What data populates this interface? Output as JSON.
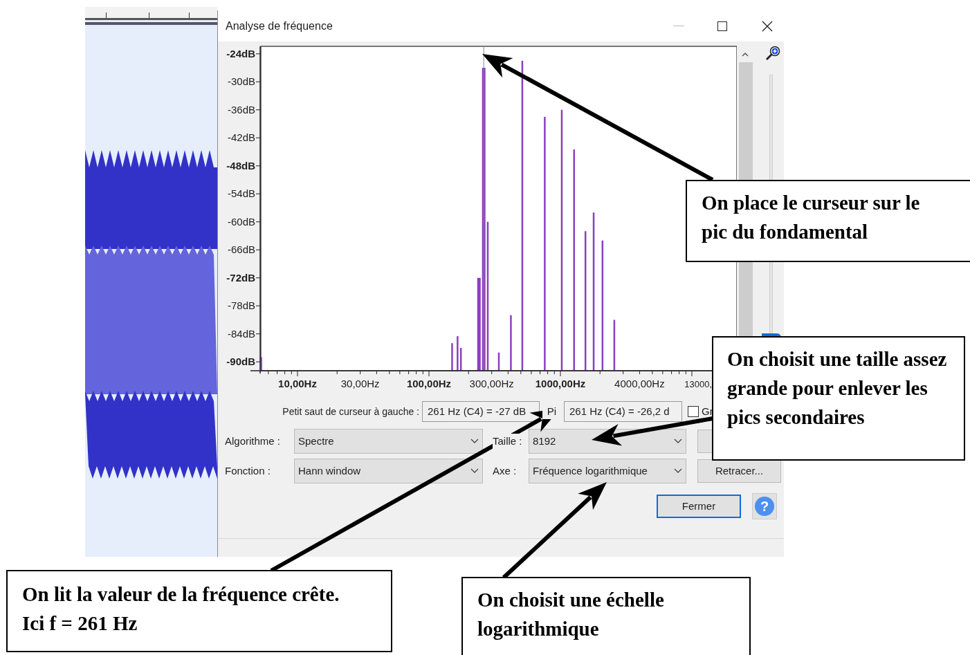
{
  "window": {
    "title": "Analyse de fréquence"
  },
  "spectrum": {
    "y_labels": [
      "-24dB",
      "-30dB",
      "-36dB",
      "-42dB",
      "-48dB",
      "-54dB",
      "-60dB",
      "-66dB",
      "-72dB",
      "-78dB",
      "-84dB",
      "-90dB"
    ],
    "x_labels": [
      "10,00Hz",
      "30,00Hz",
      "100,00Hz",
      "300,00Hz",
      "1000,00Hz",
      "4000,00Hz",
      "13000,"
    ]
  },
  "cursor_readout": {
    "label": "Petit saut de curseur à gauche :",
    "cursor_value": "261 Hz (C4) = -27 dB",
    "peak_label": "Pi",
    "peak_value": "261 Hz (C4) = -26,2 d",
    "grid": {
      "label": "Gr",
      "checked": false
    }
  },
  "settings": [
    {
      "label": "Algorithme :",
      "value": "Spectre"
    },
    {
      "label": "Taille :",
      "value": "8192"
    },
    {
      "label": "Fonction :",
      "value": "Hann window"
    },
    {
      "label": "Axe :",
      "value": "Fréquence logarithmique"
    }
  ],
  "buttons": {
    "redraw": "Retracer...",
    "close": "Fermer",
    "help": "?"
  },
  "zoom_slider": {
    "level": 0
  },
  "annotations": [
    {
      "text": "On place le curseur sur le pic du fondamental"
    },
    {
      "text": "On choisit une taille assez grande pour enlever les pics secondaires"
    },
    {
      "lines": [
        "On lit la valeur de la fréquence crête.",
        "Ici f = 261 Hz"
      ]
    },
    {
      "text": "On choisit une échelle logarithmique"
    }
  ]
}
